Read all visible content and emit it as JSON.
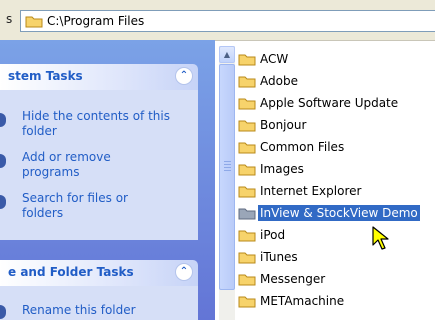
{
  "address": {
    "prefix": "s",
    "path": "C:\\Program Files"
  },
  "task_pane": {
    "system_tasks": {
      "title": "stem Tasks",
      "items": [
        {
          "label": "Hide the contents of this folder"
        },
        {
          "label": "Add or remove programs"
        },
        {
          "label": "Search for files or folders"
        }
      ]
    },
    "file_folder_tasks": {
      "title": "e and Folder Tasks",
      "items": [
        {
          "label": "Rename this folder"
        }
      ]
    }
  },
  "files": [
    "ACW",
    "Adobe",
    "Apple Software Update",
    "Bonjour",
    "Common Files",
    "Images",
    "Internet Explorer",
    "InView & StockView Demo",
    "iPod",
    "iTunes",
    "Messenger",
    "METAmachine"
  ],
  "selected_file": "InView & StockView Demo",
  "colors": {
    "task_pane_bg": "#6d8de0",
    "link_blue": "#215dc6",
    "selection": "#316ac5"
  }
}
